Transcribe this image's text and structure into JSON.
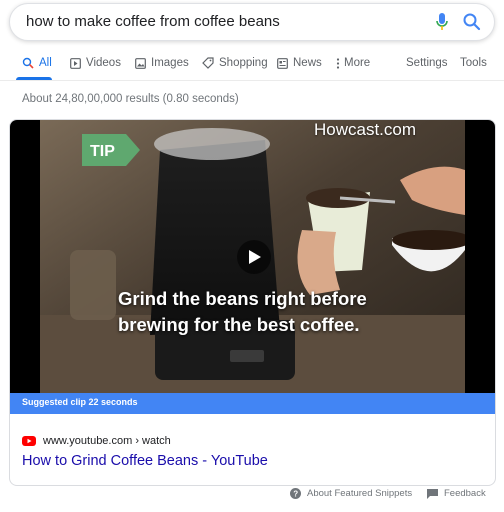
{
  "search": {
    "query": "how to make coffee from coffee beans"
  },
  "tabs": [
    {
      "label": "All",
      "icon": "search-icon",
      "active": true
    },
    {
      "label": "Videos",
      "icon": "play-square-icon"
    },
    {
      "label": "Images",
      "icon": "image-icon"
    },
    {
      "label": "Shopping",
      "icon": "tag-icon"
    },
    {
      "label": "News",
      "icon": "news-icon"
    },
    {
      "label": "More",
      "icon": "more-vertical-icon"
    },
    {
      "label": "Settings"
    },
    {
      "label": "Tools"
    }
  ],
  "results_stats": "About 24,80,00,000 results (0.80 seconds)",
  "featured_video": {
    "brand": "Howcast.com",
    "tip_label": "TIP",
    "caption_line_1": "Grind the beans right before",
    "caption_line_2": "brewing for the best coffee.",
    "suggested_clip": "Suggested clip 22 seconds",
    "source": "www.youtube.com › watch",
    "title": "How to Grind Coffee Beans - YouTube"
  },
  "footer": {
    "about_snippets": "About Featured Snippets",
    "feedback": "Feedback"
  },
  "colors": {
    "accent_blue": "#1a73e8",
    "link_blue": "#1a0dab",
    "clip_bar": "#4285f4",
    "youtube_red": "#ff0000"
  }
}
